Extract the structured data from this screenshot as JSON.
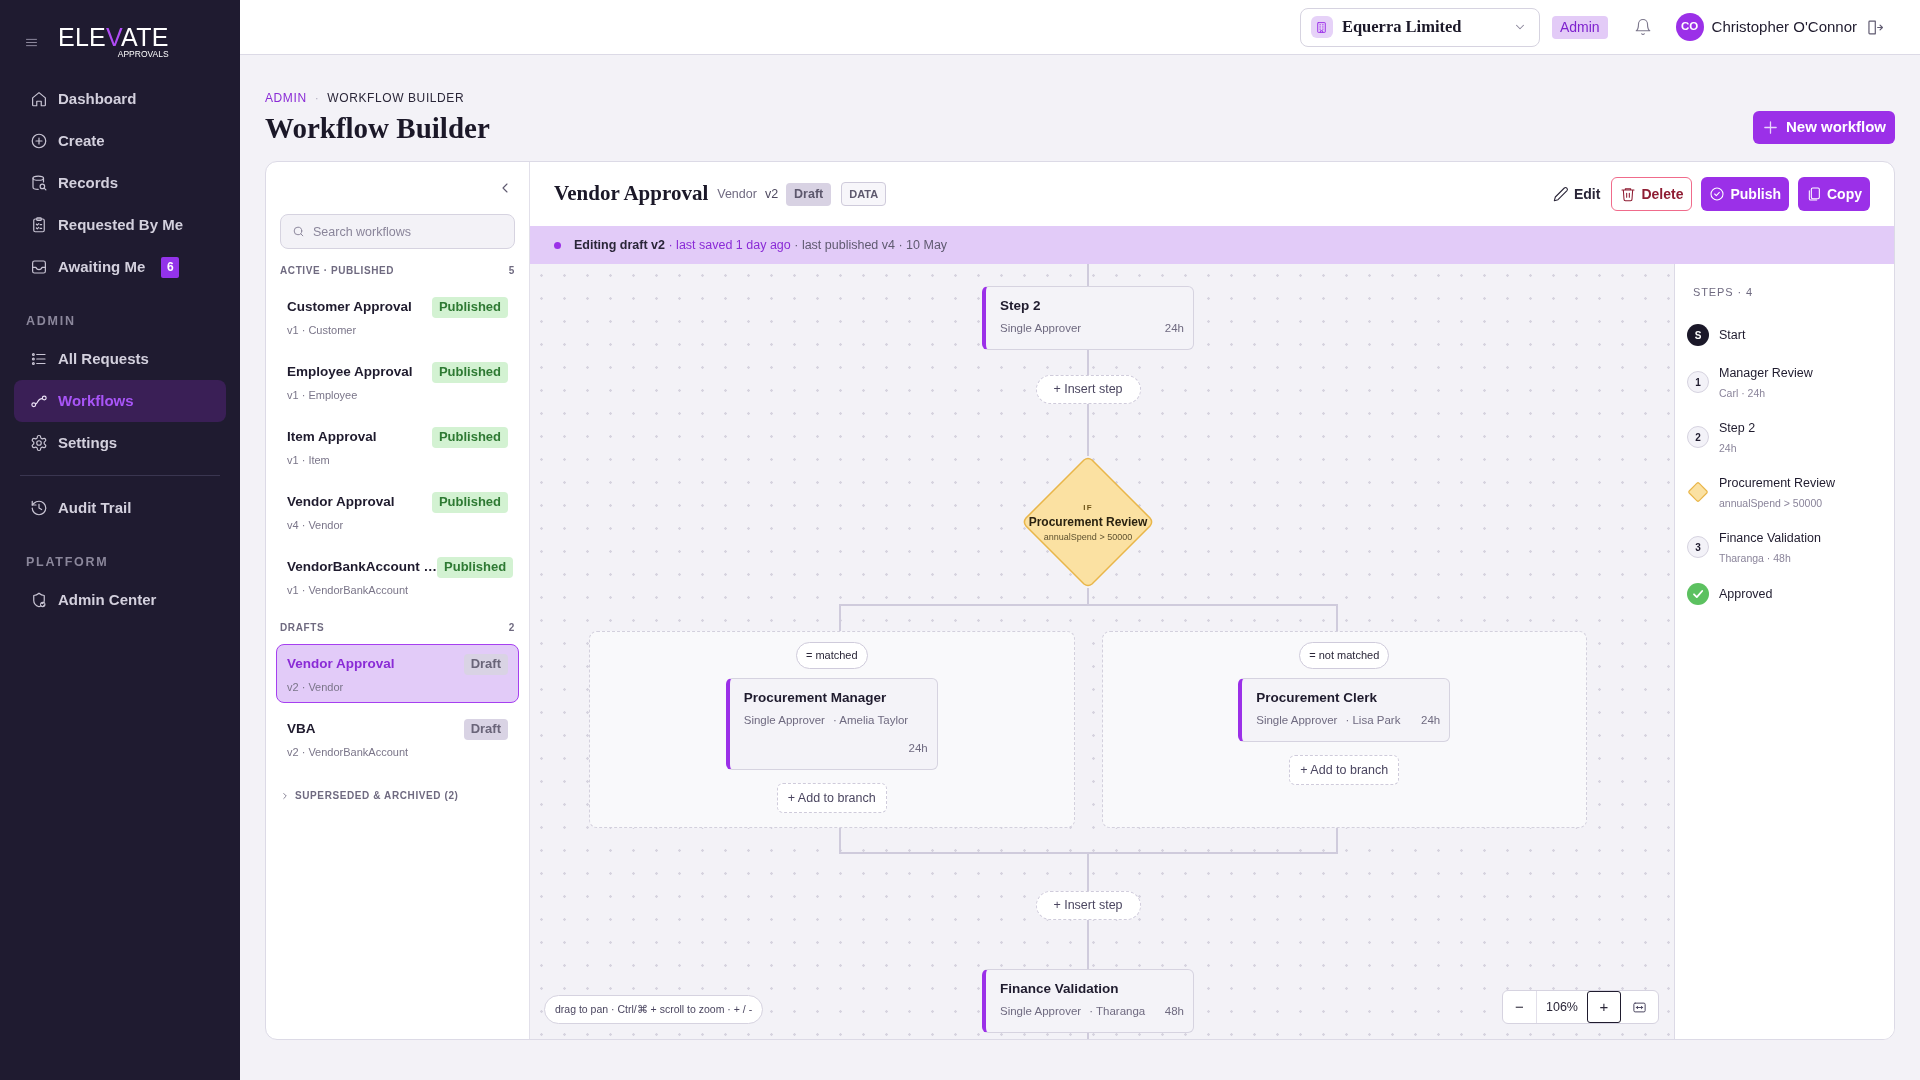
{
  "sidebar": {
    "logo": {
      "wordmark": "ELEVATE",
      "tagline": "APPROVALS"
    },
    "sections": [
      {
        "items": [
          {
            "label": "Dashboard",
            "selected": false
          },
          {
            "label": "Create",
            "selected": false
          },
          {
            "label": "Records",
            "selected": false
          },
          {
            "label": "Requested By Me",
            "selected": false
          },
          {
            "label": "Awaiting Me",
            "selected": false,
            "badge": "6"
          }
        ]
      },
      {
        "title": "ADMIN",
        "items": [
          {
            "label": "All Requests",
            "selected": false
          },
          {
            "label": "Workflows",
            "selected": true
          },
          {
            "label": "Settings",
            "selected": false
          }
        ]
      },
      {
        "items": [
          {
            "label": "Audit Trail",
            "selected": false
          }
        ]
      },
      {
        "title": "PLATFORM",
        "items": [
          {
            "label": "Admin Center",
            "selected": false
          }
        ]
      }
    ]
  },
  "topbar": {
    "organization": {
      "name": "Equerra Limited"
    },
    "role": "Admin",
    "user": {
      "initials": "CO",
      "name": "Christopher O'Connor"
    }
  },
  "page": {
    "breadcrumb": {
      "items": [
        "ADMIN",
        "WORKFLOW BUILDER"
      ],
      "separator": "·"
    },
    "title": "Workflow Builder",
    "new_button": "New workflow"
  },
  "workflow_list": {
    "search": {
      "placeholder": "Search workflows"
    },
    "groups": [
      {
        "title": "ACTIVE · PUBLISHED",
        "count": "5",
        "items": [
          {
            "name": "Customer Approval",
            "meta": "v1 · Customer",
            "status": "Published",
            "kind": "published",
            "selected": false
          },
          {
            "name": "Employee Approval",
            "meta": "v1 · Employee",
            "status": "Published",
            "kind": "published",
            "selected": false
          },
          {
            "name": "Item Approval",
            "meta": "v1 · Item",
            "status": "Published",
            "kind": "published",
            "selected": false
          },
          {
            "name": "Vendor Approval",
            "meta": "v4 · Vendor",
            "status": "Published",
            "kind": "published",
            "selected": false
          },
          {
            "name": "VendorBankAccount …",
            "meta": "v1 · VendorBankAccount",
            "status": "Published",
            "kind": "published",
            "selected": false
          }
        ]
      },
      {
        "title": "DRAFTS",
        "count": "2",
        "items": [
          {
            "name": "Vendor Approval",
            "meta": "v2 · Vendor",
            "status": "Draft",
            "kind": "draft",
            "selected": true
          },
          {
            "name": "VBA",
            "meta": "v2 · VendorBankAccount",
            "status": "Draft",
            "kind": "draft",
            "selected": false
          }
        ]
      }
    ],
    "archived": {
      "label": "SUPERSEDED & ARCHIVED (2)",
      "expanded": false
    }
  },
  "editor": {
    "title": "Vendor Approval",
    "entity": "Vendor",
    "version": "v2",
    "status": "Draft",
    "tag": "DATA",
    "actions": [
      {
        "label": "Edit",
        "kind": "ghost"
      },
      {
        "label": "Delete",
        "kind": "danger"
      },
      {
        "label": "Publish",
        "kind": "primary"
      },
      {
        "label": "Copy",
        "kind": "primary"
      }
    ],
    "banner": {
      "editing": "Editing draft v2",
      "saved": "· last saved 1 day ago",
      "published": "· last published v4 · 10 May"
    }
  },
  "canvas": {
    "nodes": [
      {
        "kind": "step",
        "title": "Step 2",
        "type": "Single Approver",
        "sla": "24h"
      },
      {
        "kind": "insert",
        "label": "+ Insert step"
      },
      {
        "kind": "condition",
        "keyword": "IF",
        "title": "Procurement Review",
        "rule": "annualSpend > 50000"
      },
      {
        "kind": "branches",
        "branches": [
          {
            "label": "= matched",
            "steps": [
              {
                "title": "Procurement Manager",
                "type": "Single Approver",
                "assignee": "· Amelia Taylor",
                "sla": "24h"
              }
            ],
            "add": "+ Add to branch"
          },
          {
            "label": "= not matched",
            "steps": [
              {
                "title": "Procurement Clerk",
                "type": "Single Approver",
                "assignee": "· Lisa Park",
                "sla": "24h"
              }
            ],
            "add": "+ Add to branch"
          }
        ]
      },
      {
        "kind": "insert",
        "label": "+ Insert step"
      },
      {
        "kind": "step",
        "title": "Finance Validation",
        "type": "Single Approver",
        "assignee": "· Tharanga",
        "sla": "48h"
      }
    ],
    "hint": "drag to pan · Ctrl/⌘ + scroll to zoom · + / -",
    "zoom_controls": {
      "zoom_out": {
        "label": "−",
        "focused": false
      },
      "level": "106%",
      "zoom_in": {
        "label": "+",
        "focused": true
      }
    }
  },
  "steps_panel": {
    "title": "STEPS · 4",
    "steps": [
      {
        "kind": "start",
        "marker": "S",
        "name": "Start"
      },
      {
        "kind": "step",
        "marker": "1",
        "name": "Manager Review",
        "detail": "Carl · 24h"
      },
      {
        "kind": "step",
        "marker": "2",
        "name": "Step 2",
        "detail": "24h"
      },
      {
        "kind": "condition",
        "name": "Procurement Review",
        "detail": "annualSpend > 50000"
      },
      {
        "kind": "step",
        "marker": "3",
        "name": "Finance Validation",
        "detail": "Tharanga · 48h"
      },
      {
        "kind": "end",
        "name": "Approved"
      }
    ]
  }
}
